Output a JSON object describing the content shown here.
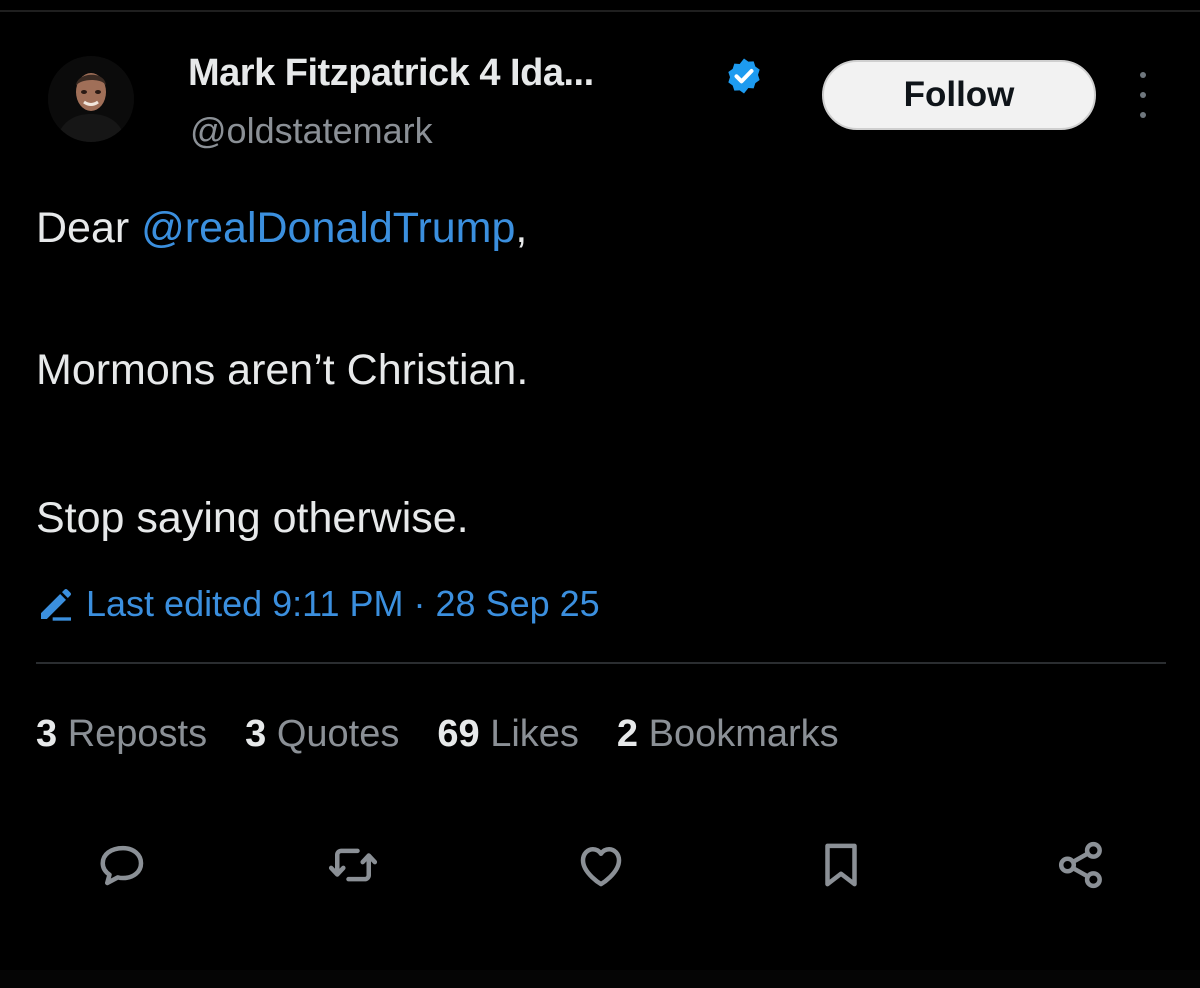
{
  "author": {
    "display_name": "Mark Fitzpatrick 4 Ida...",
    "handle": "@oldstatemark",
    "verified": true,
    "avatar_icon": "profile-photo"
  },
  "follow_button": {
    "label": "Follow"
  },
  "tweet": {
    "lines": [
      {
        "prefix": "Dear ",
        "mention": "@realDonaldTrump",
        "suffix": ","
      },
      {
        "text": "Mormons aren’t Christian."
      },
      {
        "text": "Stop saying otherwise."
      }
    ],
    "edited_label": "Last edited 9:11 PM · 28 Sep 25"
  },
  "stats": [
    {
      "count": "3",
      "label": "Reposts"
    },
    {
      "count": "3",
      "label": "Quotes"
    },
    {
      "count": "69",
      "label": "Likes"
    },
    {
      "count": "2",
      "label": "Bookmarks"
    }
  ],
  "actions": [
    "reply-icon",
    "repost-icon",
    "like-icon",
    "bookmark-icon",
    "share-icon"
  ],
  "colors": {
    "background": "#000000",
    "text": "#e7e9ea",
    "secondary_text": "#8b9096",
    "accent": "#3b8fde",
    "verified_badge": "#1d9bf0"
  }
}
